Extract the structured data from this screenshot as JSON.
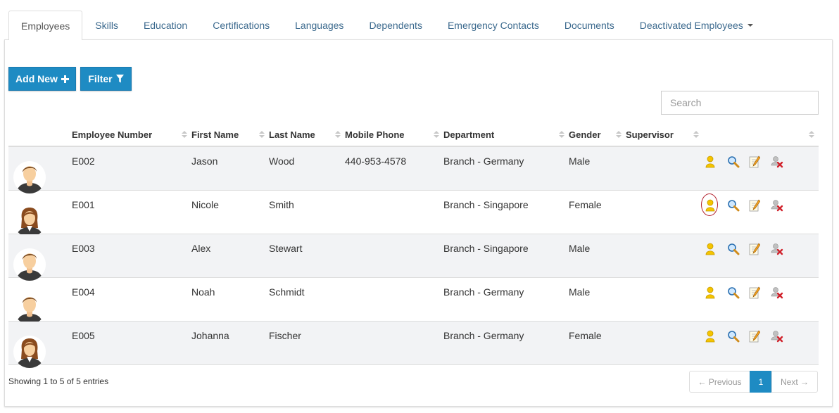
{
  "tabs": [
    {
      "label": "Employees",
      "active": true
    },
    {
      "label": "Skills"
    },
    {
      "label": "Education"
    },
    {
      "label": "Certifications"
    },
    {
      "label": "Languages"
    },
    {
      "label": "Dependents"
    },
    {
      "label": "Emergency Contacts"
    },
    {
      "label": "Documents"
    },
    {
      "label": "Deactivated Employees"
    }
  ],
  "toolbar": {
    "add_label": "Add New",
    "filter_label": "Filter"
  },
  "search": {
    "placeholder": "Search"
  },
  "table": {
    "columns": [
      "Employee Number",
      "First Name",
      "Last Name",
      "Mobile Phone",
      "Department",
      "Gender",
      "Supervisor"
    ],
    "rows": [
      {
        "avatar": "male",
        "number": "E002",
        "first": "Jason",
        "last": "Wood",
        "phone": "440-953-4578",
        "dept": "Branch - Germany",
        "gender": "Male",
        "supervisor": ""
      },
      {
        "avatar": "female",
        "number": "E001",
        "first": "Nicole",
        "last": "Smith",
        "phone": "",
        "dept": "Branch - Singapore",
        "gender": "Female",
        "supervisor": ""
      },
      {
        "avatar": "male",
        "number": "E003",
        "first": "Alex",
        "last": "Stewart",
        "phone": "",
        "dept": "Branch - Singapore",
        "gender": "Male",
        "supervisor": ""
      },
      {
        "avatar": "male",
        "number": "E004",
        "first": "Noah",
        "last": "Schmidt",
        "phone": "",
        "dept": "Branch - Germany",
        "gender": "Male",
        "supervisor": ""
      },
      {
        "avatar": "female",
        "number": "E005",
        "first": "Johanna",
        "last": "Fischer",
        "phone": "",
        "dept": "Branch - Germany",
        "gender": "Female",
        "supervisor": ""
      }
    ],
    "action_icons": [
      "user-icon",
      "search-icon",
      "edit-icon",
      "remove-user-icon"
    ]
  },
  "footer": {
    "info": "Showing 1 to 5 of 5 entries"
  },
  "pagination": {
    "previous": "← Previous",
    "current": "1",
    "next": "Next →"
  },
  "colors": {
    "primary": "#1e8bc3",
    "highlight_ring": "#b3232f",
    "tab_text": "#3c6a8e"
  }
}
